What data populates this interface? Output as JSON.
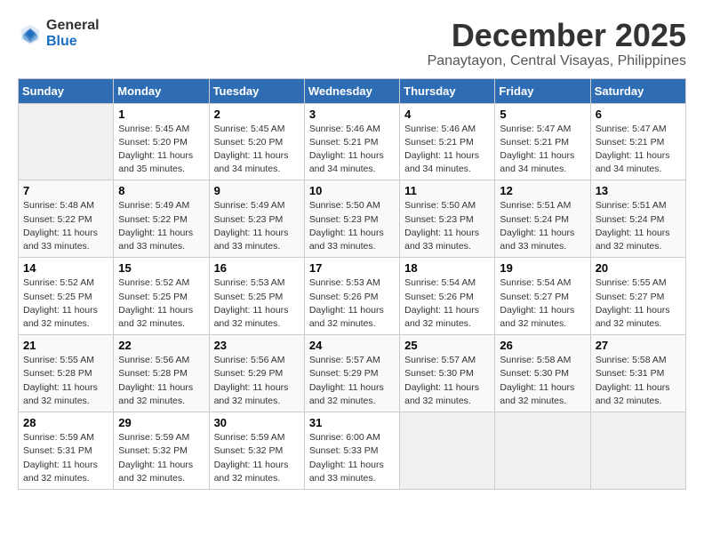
{
  "logo": {
    "general": "General",
    "blue": "Blue"
  },
  "title": {
    "month": "December 2025",
    "location": "Panaytayon, Central Visayas, Philippines"
  },
  "weekdays": [
    "Sunday",
    "Monday",
    "Tuesday",
    "Wednesday",
    "Thursday",
    "Friday",
    "Saturday"
  ],
  "weeks": [
    [
      {
        "day": "",
        "info": ""
      },
      {
        "day": "1",
        "info": "Sunrise: 5:45 AM\nSunset: 5:20 PM\nDaylight: 11 hours\nand 35 minutes."
      },
      {
        "day": "2",
        "info": "Sunrise: 5:45 AM\nSunset: 5:20 PM\nDaylight: 11 hours\nand 34 minutes."
      },
      {
        "day": "3",
        "info": "Sunrise: 5:46 AM\nSunset: 5:21 PM\nDaylight: 11 hours\nand 34 minutes."
      },
      {
        "day": "4",
        "info": "Sunrise: 5:46 AM\nSunset: 5:21 PM\nDaylight: 11 hours\nand 34 minutes."
      },
      {
        "day": "5",
        "info": "Sunrise: 5:47 AM\nSunset: 5:21 PM\nDaylight: 11 hours\nand 34 minutes."
      },
      {
        "day": "6",
        "info": "Sunrise: 5:47 AM\nSunset: 5:21 PM\nDaylight: 11 hours\nand 34 minutes."
      }
    ],
    [
      {
        "day": "7",
        "info": "Sunrise: 5:48 AM\nSunset: 5:22 PM\nDaylight: 11 hours\nand 33 minutes."
      },
      {
        "day": "8",
        "info": "Sunrise: 5:49 AM\nSunset: 5:22 PM\nDaylight: 11 hours\nand 33 minutes."
      },
      {
        "day": "9",
        "info": "Sunrise: 5:49 AM\nSunset: 5:23 PM\nDaylight: 11 hours\nand 33 minutes."
      },
      {
        "day": "10",
        "info": "Sunrise: 5:50 AM\nSunset: 5:23 PM\nDaylight: 11 hours\nand 33 minutes."
      },
      {
        "day": "11",
        "info": "Sunrise: 5:50 AM\nSunset: 5:23 PM\nDaylight: 11 hours\nand 33 minutes."
      },
      {
        "day": "12",
        "info": "Sunrise: 5:51 AM\nSunset: 5:24 PM\nDaylight: 11 hours\nand 33 minutes."
      },
      {
        "day": "13",
        "info": "Sunrise: 5:51 AM\nSunset: 5:24 PM\nDaylight: 11 hours\nand 32 minutes."
      }
    ],
    [
      {
        "day": "14",
        "info": "Sunrise: 5:52 AM\nSunset: 5:25 PM\nDaylight: 11 hours\nand 32 minutes."
      },
      {
        "day": "15",
        "info": "Sunrise: 5:52 AM\nSunset: 5:25 PM\nDaylight: 11 hours\nand 32 minutes."
      },
      {
        "day": "16",
        "info": "Sunrise: 5:53 AM\nSunset: 5:25 PM\nDaylight: 11 hours\nand 32 minutes."
      },
      {
        "day": "17",
        "info": "Sunrise: 5:53 AM\nSunset: 5:26 PM\nDaylight: 11 hours\nand 32 minutes."
      },
      {
        "day": "18",
        "info": "Sunrise: 5:54 AM\nSunset: 5:26 PM\nDaylight: 11 hours\nand 32 minutes."
      },
      {
        "day": "19",
        "info": "Sunrise: 5:54 AM\nSunset: 5:27 PM\nDaylight: 11 hours\nand 32 minutes."
      },
      {
        "day": "20",
        "info": "Sunrise: 5:55 AM\nSunset: 5:27 PM\nDaylight: 11 hours\nand 32 minutes."
      }
    ],
    [
      {
        "day": "21",
        "info": "Sunrise: 5:55 AM\nSunset: 5:28 PM\nDaylight: 11 hours\nand 32 minutes."
      },
      {
        "day": "22",
        "info": "Sunrise: 5:56 AM\nSunset: 5:28 PM\nDaylight: 11 hours\nand 32 minutes."
      },
      {
        "day": "23",
        "info": "Sunrise: 5:56 AM\nSunset: 5:29 PM\nDaylight: 11 hours\nand 32 minutes."
      },
      {
        "day": "24",
        "info": "Sunrise: 5:57 AM\nSunset: 5:29 PM\nDaylight: 11 hours\nand 32 minutes."
      },
      {
        "day": "25",
        "info": "Sunrise: 5:57 AM\nSunset: 5:30 PM\nDaylight: 11 hours\nand 32 minutes."
      },
      {
        "day": "26",
        "info": "Sunrise: 5:58 AM\nSunset: 5:30 PM\nDaylight: 11 hours\nand 32 minutes."
      },
      {
        "day": "27",
        "info": "Sunrise: 5:58 AM\nSunset: 5:31 PM\nDaylight: 11 hours\nand 32 minutes."
      }
    ],
    [
      {
        "day": "28",
        "info": "Sunrise: 5:59 AM\nSunset: 5:31 PM\nDaylight: 11 hours\nand 32 minutes."
      },
      {
        "day": "29",
        "info": "Sunrise: 5:59 AM\nSunset: 5:32 PM\nDaylight: 11 hours\nand 32 minutes."
      },
      {
        "day": "30",
        "info": "Sunrise: 5:59 AM\nSunset: 5:32 PM\nDaylight: 11 hours\nand 32 minutes."
      },
      {
        "day": "31",
        "info": "Sunrise: 6:00 AM\nSunset: 5:33 PM\nDaylight: 11 hours\nand 33 minutes."
      },
      {
        "day": "",
        "info": ""
      },
      {
        "day": "",
        "info": ""
      },
      {
        "day": "",
        "info": ""
      }
    ]
  ]
}
